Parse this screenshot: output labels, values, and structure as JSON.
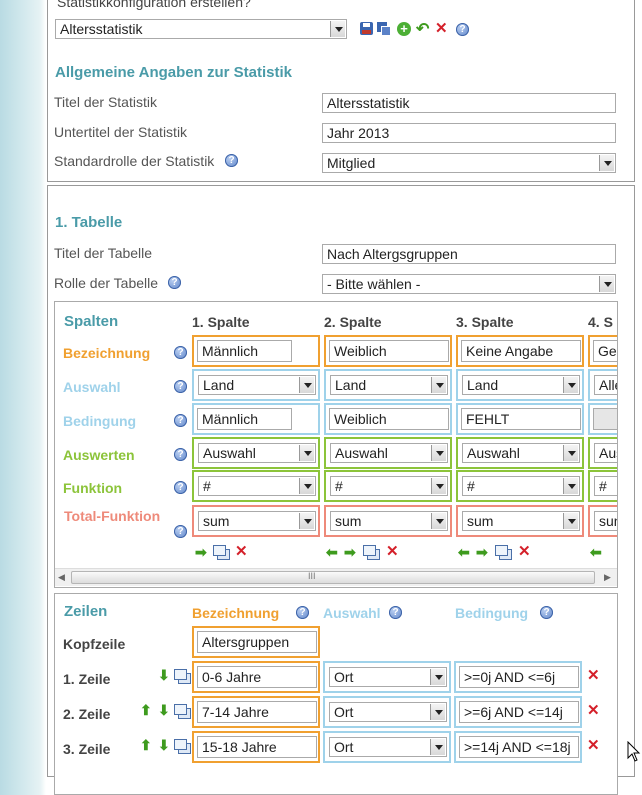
{
  "top": {
    "section_label": "Statistikkonfiguration erstellen?",
    "config_select": "Altersstatistik"
  },
  "general": {
    "heading": "Allgemeine Angaben zur Statistik",
    "title_label": "Titel der Statistik",
    "title_value": "Altersstatistik",
    "subtitle_label": "Untertitel der Statistik",
    "subtitle_value": "Jahr 2013",
    "role_label": "Standardrolle der Statistik",
    "role_value": "Mitglied"
  },
  "table1": {
    "heading": "1. Tabelle",
    "title_label": "Titel der Tabelle",
    "title_value": "Nach Altergsgruppen",
    "role_label": "Rolle der Tabelle",
    "role_value": "- Bitte wählen -"
  },
  "columns": {
    "heading": "Spalten",
    "headers": [
      "1. Spalte",
      "2. Spalte",
      "3. Spalte",
      "4. S"
    ],
    "row_labels": {
      "bezeichnung": "Bezeichnung",
      "auswahl": "Auswahl",
      "bedingung": "Bedingung",
      "auswerten": "Auswerten",
      "funktion": "Funktion",
      "total": "Total-Funktion"
    },
    "bezeichnung": [
      "Männlich",
      "Weiblich",
      "Keine Angabe",
      "Ges"
    ],
    "auswahl": [
      "Land",
      "Land",
      "Land",
      "Alle"
    ],
    "bedingung": [
      "Männlich",
      "Weiblich",
      "FEHLT",
      ""
    ],
    "auswerten": [
      "Auswahl",
      "Auswahl",
      "Auswahl",
      "Aus"
    ],
    "funktion": [
      "#",
      "#",
      "#",
      "#"
    ],
    "total": [
      "sum",
      "sum",
      "sum",
      "sun"
    ],
    "scroll_grip": "III"
  },
  "rows": {
    "heading": "Zeilen",
    "col_bezeichnung": "Bezeichnung",
    "col_auswahl": "Auswahl",
    "col_bedingung": "Bedingung",
    "kopfzeile_label": "Kopfzeile",
    "kopfzeile_value": "Altersgruppen",
    "items": [
      {
        "label": "1. Zeile",
        "bez": "0-6 Jahre",
        "auswahl": "Ort",
        "bed": ">=0j AND <=6j"
      },
      {
        "label": "2. Zeile",
        "bez": "7-14 Jahre",
        "auswahl": "Ort",
        "bed": ">=6j AND <=14j"
      },
      {
        "label": "3. Zeile",
        "bez": "15-18 Jahre",
        "auswahl": "Ort",
        "bed": ">=14j AND <=18j"
      }
    ]
  },
  "colors": {
    "heading": "#4a9ba8",
    "bezeichnung": "#f0a030",
    "auswahl": "#9fd2ea",
    "auswerten": "#8cc43a",
    "total": "#ee8a7a"
  }
}
